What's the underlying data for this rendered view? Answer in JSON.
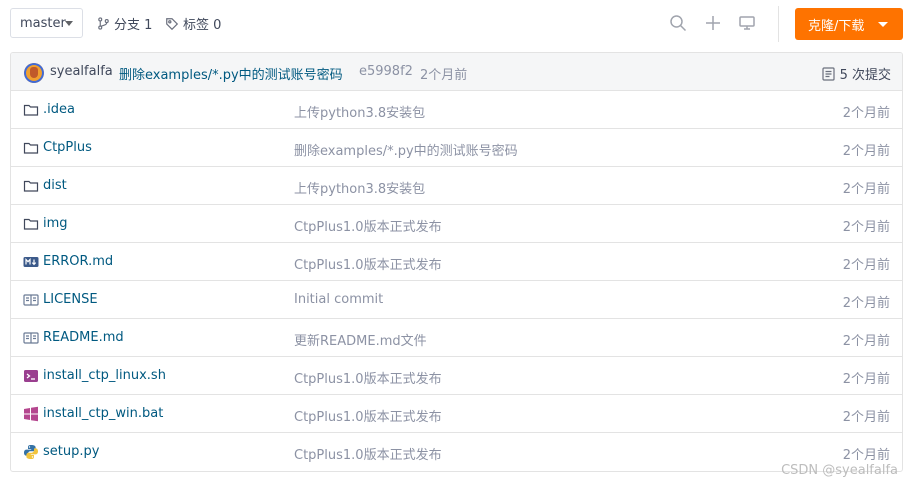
{
  "toolbar": {
    "branch_select": "master",
    "branches_label": "分支 1",
    "tags_label": "标签 0",
    "clone_button": "克隆/下载"
  },
  "commit": {
    "author": "syealfalfa",
    "message": "删除examples/*.py中的测试账号密码",
    "sha": "e5998f2",
    "time": "2个月前",
    "commits_count": "5 次提交"
  },
  "files": [
    {
      "icon": "folder-icon",
      "name": ".idea",
      "message": "上传python3.8安装包",
      "time": "2个月前"
    },
    {
      "icon": "folder-icon",
      "name": "CtpPlus",
      "message": "删除examples/*.py中的测试账号密码",
      "time": "2个月前"
    },
    {
      "icon": "folder-icon",
      "name": "dist",
      "message": "上传python3.8安装包",
      "time": "2个月前"
    },
    {
      "icon": "folder-icon",
      "name": "img",
      "message": "CtpPlus1.0版本正式发布",
      "time": "2个月前"
    },
    {
      "icon": "markdown-icon",
      "name": "ERROR.md",
      "message": "CtpPlus1.0版本正式发布",
      "time": "2个月前"
    },
    {
      "icon": "book-icon",
      "name": "LICENSE",
      "message": "Initial commit",
      "time": "2个月前"
    },
    {
      "icon": "book-icon",
      "name": "README.md",
      "message": "更新README.md文件",
      "time": "2个月前"
    },
    {
      "icon": "terminal-icon",
      "name": "install_ctp_linux.sh",
      "message": "CtpPlus1.0版本正式发布",
      "time": "2个月前"
    },
    {
      "icon": "windows-icon",
      "name": "install_ctp_win.bat",
      "message": "CtpPlus1.0版本正式发布",
      "time": "2个月前"
    },
    {
      "icon": "python-icon",
      "name": "setup.py",
      "message": "CtpPlus1.0版本正式发布",
      "time": "2个月前"
    }
  ],
  "watermark": "CSDN @syealfalfa",
  "colors": {
    "accent": "#fe7300",
    "link": "#005980",
    "muted": "#8c92a4"
  }
}
